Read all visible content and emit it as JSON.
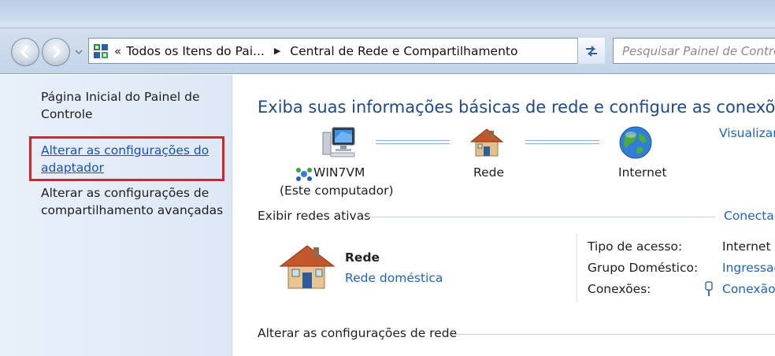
{
  "window": {
    "address_segments": [
      "Todos os Itens do Pai...",
      "Central de Rede e Compartilhamento"
    ],
    "search_placeholder": "Pesquisar Painel de Controle"
  },
  "sidebar": {
    "items": [
      {
        "label": "Página Inicial do Painel de Controle",
        "link": false
      },
      {
        "label": "Alterar as configurações do adaptador",
        "link": true,
        "highlighted": true
      },
      {
        "label": "Alterar as configurações de compartilhamento avançadas",
        "link": false
      }
    ]
  },
  "main": {
    "heading": "Exiba suas informações básicas de rede e configure as conexões",
    "see_full_map": "Visualizar",
    "map": {
      "computer_name": "WIN7VM",
      "computer_sub": "(Este computador)",
      "network": "Rede",
      "internet": "Internet"
    },
    "active_networks": {
      "title": "Exibir redes ativas",
      "link": "Conectar",
      "network_name": "Rede",
      "network_type": "Rede doméstica",
      "details": [
        {
          "key": "Tipo de acesso:",
          "value": "Internet",
          "link": false
        },
        {
          "key": "Grupo Doméstico:",
          "value": "Ingressado",
          "link": true
        },
        {
          "key": "Conexões:",
          "value": "Conexão",
          "link": true
        }
      ]
    },
    "change_settings": {
      "title": "Alterar as configurações de rede"
    }
  },
  "colors": {
    "heading_blue": "#1d4a8c",
    "link_blue": "#1a64c5",
    "highlight_red": "#e01f26",
    "sidebar_bg": "#dde8f6"
  }
}
